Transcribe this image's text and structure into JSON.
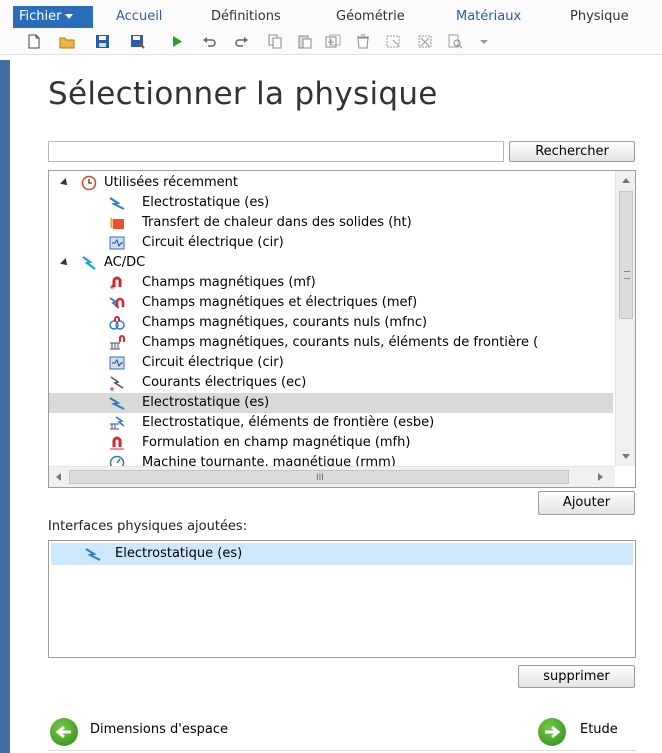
{
  "ribbon": {
    "file_label": "Fichier",
    "tabs": [
      {
        "label": "Accueil"
      },
      {
        "label": "Définitions"
      },
      {
        "label": "Géométrie"
      },
      {
        "label": "Matériaux"
      },
      {
        "label": "Physique"
      }
    ]
  },
  "toolbar": {
    "icons": [
      "new-file-icon",
      "open-folder-icon",
      "save-icon",
      "save-as-icon",
      "run-icon",
      "undo-icon",
      "redo-icon",
      "copy-icon",
      "paste-icon",
      "duplicate-icon",
      "delete-icon",
      "select-icon",
      "deselect-icon",
      "find-icon",
      "more-icon"
    ]
  },
  "page": {
    "title": "Sélectionner la physique"
  },
  "search": {
    "value": "",
    "button": "Rechercher"
  },
  "tree": {
    "groups": [
      {
        "label": "Utilisées récemment",
        "icon": "recent-clock-icon",
        "items": [
          {
            "label": "Electrostatique (es)",
            "icon": "electrostatics-icon"
          },
          {
            "label": "Transfert de chaleur dans des solides (ht)",
            "icon": "heat-transfer-icon"
          },
          {
            "label": "Circuit électrique (cir)",
            "icon": "electrical-circuit-icon"
          }
        ]
      },
      {
        "label": "AC/DC",
        "icon": "acdc-lightning-icon",
        "items": [
          {
            "label": "Champs magnétiques (mf)",
            "icon": "magnetic-fields-icon"
          },
          {
            "label": "Champs magnétiques et électriques (mef)",
            "icon": "magnetic-electric-fields-icon"
          },
          {
            "label": "Champs magnétiques, courants nuls (mfnc)",
            "icon": "magnetic-no-currents-icon"
          },
          {
            "label": "Champs magnétiques, courants nuls, éléments de frontière (",
            "icon": "magnetic-boundary-elements-icon"
          },
          {
            "label": "Circuit électrique (cir)",
            "icon": "electrical-circuit-icon"
          },
          {
            "label": "Courants électriques (ec)",
            "icon": "electric-currents-icon"
          },
          {
            "label": "Electrostatique (es)",
            "icon": "electrostatics-icon",
            "selected": true
          },
          {
            "label": "Electrostatique, éléments de frontière (esbe)",
            "icon": "electrostatics-boundary-icon"
          },
          {
            "label": "Formulation en champ magnétique (mfh)",
            "icon": "magnetic-field-formulation-icon"
          },
          {
            "label": "Machine tournante, magnétique (rmm)",
            "icon": "rotating-machinery-icon"
          }
        ]
      }
    ],
    "hscroll_grip": "III"
  },
  "add_button": "Ajouter",
  "added": {
    "label": "Interfaces physiques ajoutées:",
    "items": [
      {
        "label": "Electrostatique (es)",
        "icon": "electrostatics-icon"
      }
    ]
  },
  "remove_button": "supprimer",
  "nav": {
    "back_label": "Dimensions d'espace",
    "next_label": "Etude"
  },
  "colors": {
    "file_tab": "#2a6ebb",
    "accent": "#3f6fa6",
    "selection": "#d9d9d9",
    "added_selection": "#cde8fb",
    "nav_green": "#3c9b1c"
  }
}
